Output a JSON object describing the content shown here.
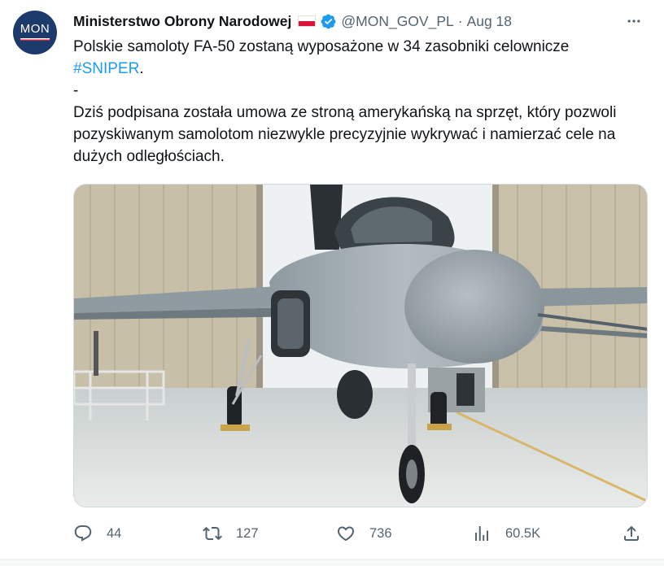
{
  "account": {
    "display_name": "Ministerstwo Obrony Narodowej",
    "handle": "@MON_GOV_PL",
    "separator": "·",
    "date": "Aug 18",
    "avatar_text": "MON",
    "avatar_color": "#1d3a6c",
    "verified_icon": "verified-badge-icon",
    "flag_icon": "poland-flag-icon"
  },
  "tweet": {
    "line1": "Polskie samoloty FA-50 zostaną wyposażone w 34 zasobniki celownicze",
    "hashtag": "#SNIPER",
    "hashtag_suffix": ".",
    "separator": "-",
    "line3": "Dziś podpisana została umowa ze stroną amerykańską na sprzęt, który pozwoli pozyskiwanym samolotom niezwykle precyzyjnie wykrywać i namierzać cele na dużych odległościach."
  },
  "actions": {
    "reply_count": "44",
    "retweet_count": "127",
    "like_count": "736",
    "views_count": "60.5K",
    "icons": [
      "reply-icon",
      "retweet-icon",
      "like-icon",
      "views-icon",
      "share-icon"
    ]
  },
  "colors": {
    "accent": "#1d9bf0",
    "secondary_text": "#536471",
    "primary_text": "#0f1419"
  }
}
